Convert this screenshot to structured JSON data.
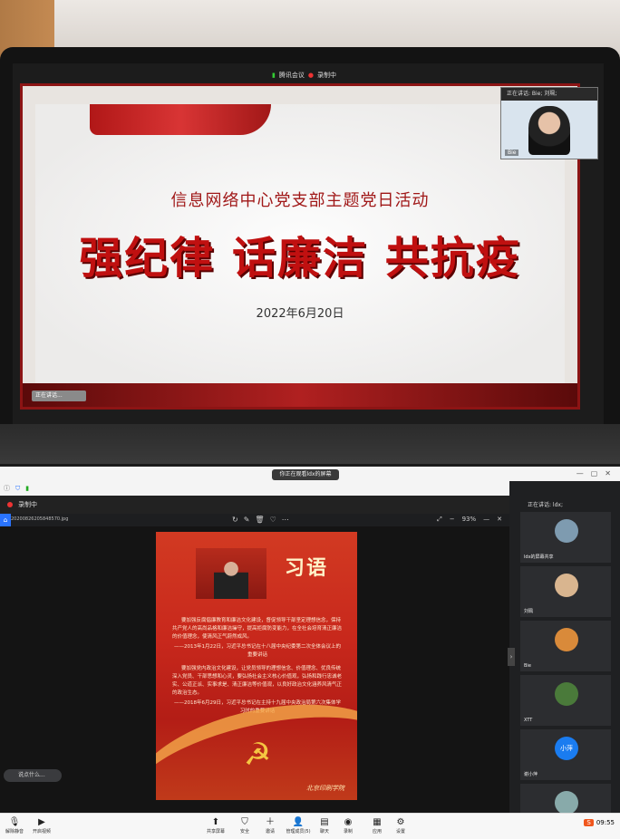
{
  "photo": {
    "meeting_bar": {
      "app": "腾讯会议",
      "recording": "录制中"
    },
    "slide": {
      "subtitle": "信息网络中心党支部主题党日活动",
      "title": "强纪律  话廉洁  共抗疫",
      "date": "2022年6月20日",
      "speaker_tip": "正在讲话..."
    },
    "video": {
      "talking": "正在讲话: Bie; 刘珮;",
      "name": "Bie"
    }
  },
  "app": {
    "share_banner": "你正在观看ldx的屏幕",
    "recording_label": "录制中",
    "file_name": "20200826205848570.jpg",
    "zoom": "93%",
    "poster": {
      "heading": "习语",
      "para1": "要加强反腐倡廉教育和廉洁文化建设，督促领导干部坚定理想信念，保持共产党人的高尚品格和廉洁操守，提高拒腐防变能力，在全社会培育清正廉洁的价值理念，使清风正气蔚然成风。",
      "ref1": "——2013年1月22日，习近平总书记在十八届中央纪委第二次全体会议上的重要讲话",
      "para2": "要加强党内政治文化建设，让党员领导的理想信念、价值理念、优良传统深入党员、干部思想和心灵，要弘扬社会主义核心价值观，弘扬和践行忠诚老实、公道正派、实事求是、清正廉洁等价值观，以良好政治文化涵养风清气正的政治生态。",
      "ref2": "——2018年6月29日，习近平总书记在主持十九届中央政治局第六次集体学习时的重要讲话",
      "signature": "北京印刷学院"
    },
    "chat_placeholder": "说点什么...",
    "side_panel": {
      "talking": "正在讲话: ldx;",
      "participants": [
        {
          "name": "ldx的屏幕共享",
          "color": "#7e9bb0"
        },
        {
          "name": "刘珮",
          "color": "#d9b58f"
        },
        {
          "name": "Bie",
          "color": "#d98a3a"
        },
        {
          "name": "XTT",
          "color": "#4a7a3a"
        },
        {
          "name": "谢小萍",
          "color": "#1a7cf0",
          "initials": "小萍"
        }
      ]
    },
    "toolbar": {
      "mute": "解除静音",
      "video": "开启视频",
      "share": "共享屏幕",
      "security": "安全",
      "invite": "邀请",
      "manage": "管理成员(5)",
      "chat": "聊天",
      "record": "录制",
      "apps": "应用",
      "settings": "设置"
    },
    "tray_time": "09:55"
  }
}
